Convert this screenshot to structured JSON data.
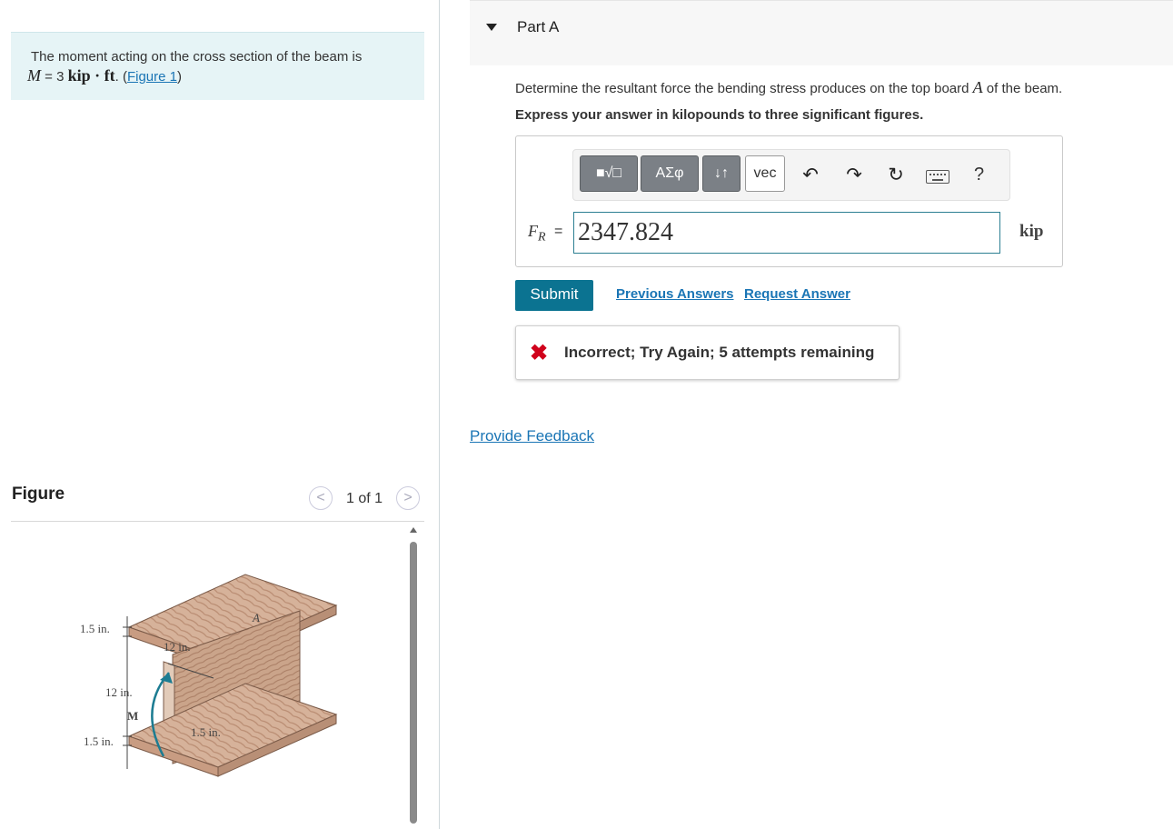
{
  "problem": {
    "text_before": "The moment acting on the cross section of the beam is",
    "math_var": "M",
    "math_eq": " = 3 ",
    "math_units": "kip · ft",
    "after_units": ". (",
    "figure_link": "Figure 1",
    "close": ")"
  },
  "figure_panel": {
    "title": "Figure",
    "prev_icon": "chevron-left-icon",
    "next_icon": "chevron-right-icon",
    "pager": "1 of 1",
    "labels": {
      "top_thk": "1.5 in.",
      "width": "12 in.",
      "web_h": "12 in.",
      "web_thk": "1.5 in.",
      "bot_thk": "1.5 in.",
      "board": "A",
      "moment": "M"
    }
  },
  "part": {
    "title": "Part A",
    "question_before": "Determine the resultant force the bending stress produces on the top board ",
    "question_var": "A",
    "question_after": " of the beam.",
    "instruction": "Express your answer in kilopounds to three significant figures."
  },
  "toolbar": {
    "template_btn": "■√□",
    "greek_btn": "ΑΣφ",
    "arrows_btn": "↓↑",
    "vec_btn": "vec",
    "undo_icon": "undo-icon",
    "redo_icon": "redo-icon",
    "reset_icon": "reset-icon",
    "keyboard_icon": "keyboard-icon",
    "help": "?"
  },
  "answer": {
    "label_main": "F",
    "label_sub": "R",
    "equals": "=",
    "value": "2347.824",
    "unit": "kip"
  },
  "actions": {
    "submit": "Submit",
    "previous": "Previous Answers",
    "request": "Request Answer"
  },
  "feedback": {
    "icon": "x-icon",
    "text": "Incorrect; Try Again; 5 attempts remaining"
  },
  "provide_feedback": "Provide Feedback",
  "colors": {
    "accent": "#0b7391",
    "link": "#1a75b5",
    "error": "#d0021b",
    "problem_bg": "#e6f4f6"
  }
}
